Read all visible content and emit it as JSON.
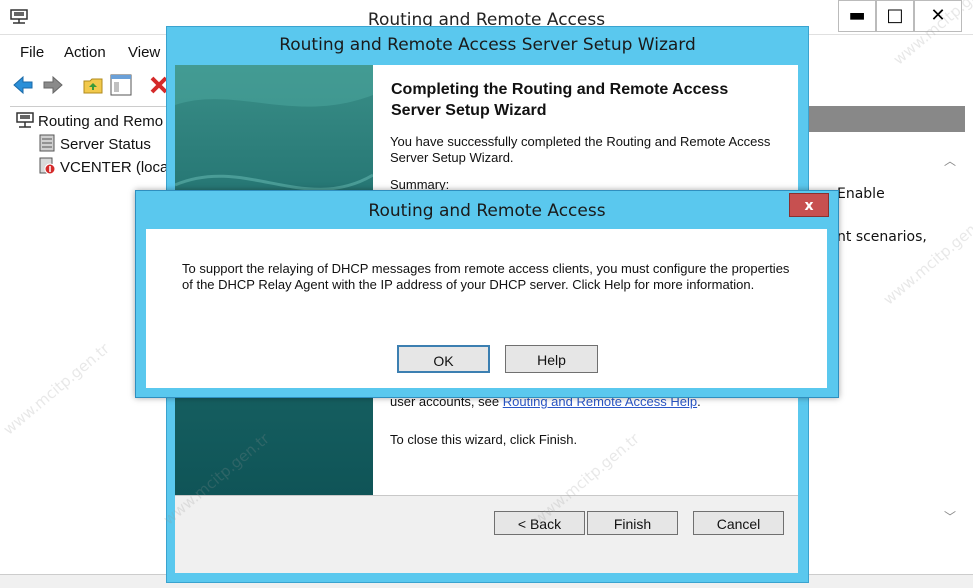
{
  "mmc": {
    "title": "Routing and Remote Access",
    "window_controls": {
      "minimize": "▬",
      "maximize": "□",
      "close": "✕"
    },
    "menu": [
      "File",
      "Action",
      "View"
    ],
    "toolbar_icons": [
      "back-arrow-icon",
      "forward-arrow-icon",
      "folder-up-icon",
      "show-hide-pane-icon",
      "delete-icon"
    ],
    "tree": [
      {
        "label": "Routing and Remo",
        "icon": "server-tree-icon"
      },
      {
        "label": "Server Status",
        "icon": "server-status-icon"
      },
      {
        "label": "VCENTER (loca",
        "icon": "server-down-icon"
      }
    ],
    "right_pane_fragments": [
      "Enable",
      "nt scenarios,"
    ]
  },
  "wizard": {
    "title": "Routing and Remote Access Server Setup Wizard",
    "heading": "Completing the Routing and Remote Access Server Setup Wizard",
    "intro": "You have successfully completed the Routing and Remote Access Server Setup Wizard.",
    "summary_label": "Summary:",
    "accounts_prefix": "user accounts, see ",
    "help_link": "Routing and Remote Access Help",
    "accounts_suffix": ".",
    "close_note": "To close this wizard, click Finish.",
    "buttons": {
      "back": "< Back",
      "finish": "Finish",
      "cancel": "Cancel"
    }
  },
  "dialog": {
    "title": "Routing and Remote Access",
    "message_line1": "To support the relaying of DHCP messages from remote access clients, you must configure the properties",
    "message_line2": "of the DHCP Relay Agent with the IP address of your DHCP server. Click Help for more information.",
    "close": "x",
    "buttons": {
      "ok": "OK",
      "help": "Help"
    }
  },
  "watermark": "www.mcitp.gen.tr",
  "colors": {
    "dialog_frame": "#5ac8ee",
    "close_button": "#c75050",
    "link": "#2a56c6",
    "wizard_side": "#1f6e6d"
  }
}
